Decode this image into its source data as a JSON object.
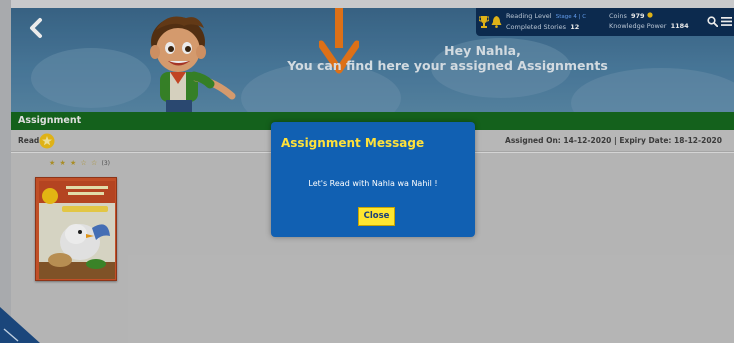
{
  "header": {
    "greeting_line1": "Hey Nahla,",
    "greeting_line2": "You can find here your assigned Assignments"
  },
  "stats": {
    "reading_level_label": "Reading Level",
    "reading_level_value": "Stage 4 | C",
    "completed_stories_label": "Completed Stories",
    "completed_stories_value": "12",
    "coins_label": "Coins",
    "coins_value": "979",
    "knowledge_power_label": "Knowledge Power",
    "knowledge_power_value": "1184"
  },
  "section": {
    "title": "Assignment"
  },
  "assignment": {
    "type_label": "Read",
    "assigned_on": "Assigned On: 14-12-2020 | Expiry Date: 18-12-2020",
    "rating_stars": "★ ★ ★ ☆ ☆",
    "rating_count": "(3)",
    "rating_value": 3,
    "rating_max": 5
  },
  "modal": {
    "title": "Assignment Message",
    "message": "Let's Read with Nahla wa Nahil !",
    "close_label": "Close"
  },
  "icons": {
    "back": "chevron-left-icon",
    "search": "search-icon",
    "menu": "menu-icon",
    "trophy": "trophy-icon",
    "bell": "bell-icon"
  },
  "colors": {
    "banner": "#4c7ea2",
    "green_bar": "#166a1f",
    "modal": "#1160b2",
    "modal_title": "#ffe13a",
    "close_button": "#ffe630",
    "arrow": "#f07a1a"
  }
}
